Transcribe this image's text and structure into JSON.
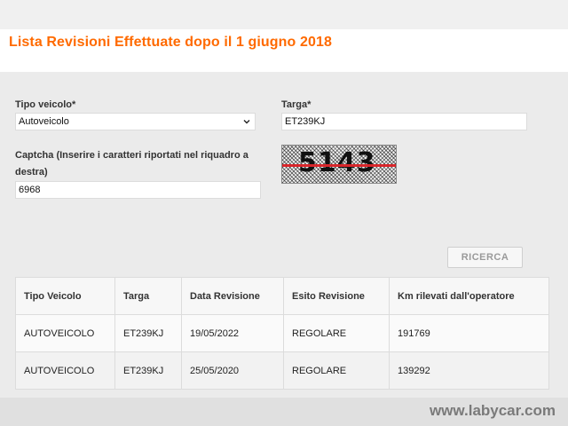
{
  "header": {
    "title": "Lista Revisioni Effettuate dopo il 1 giugno 2018"
  },
  "form": {
    "tipo_veicolo": {
      "label": "Tipo veicolo*",
      "value": "Autoveicolo",
      "icon": "chevron-down-icon"
    },
    "targa": {
      "label": "Targa*",
      "value": "ET239KJ"
    },
    "captcha": {
      "label_line1": "Captcha (Inserire i caratteri riportati nel riquadro a",
      "label_line2": "destra)",
      "value": "6968",
      "image_text": "5143"
    },
    "search_button": "RICERCA"
  },
  "table": {
    "headers": [
      "Tipo Veicolo",
      "Targa",
      "Data Revisione",
      "Esito Revisione",
      "Km rilevati dall'operatore"
    ],
    "rows": [
      [
        "AUTOVEICOLO",
        "ET239KJ",
        "19/05/2022",
        "REGOLARE",
        "191769"
      ],
      [
        "AUTOVEICOLO",
        "ET239KJ",
        "25/05/2020",
        "REGOLARE",
        "139292"
      ]
    ]
  },
  "watermark": "www.labycar.com",
  "colors": {
    "accent": "#ff6a00",
    "captcha_line": "#d8262b"
  }
}
